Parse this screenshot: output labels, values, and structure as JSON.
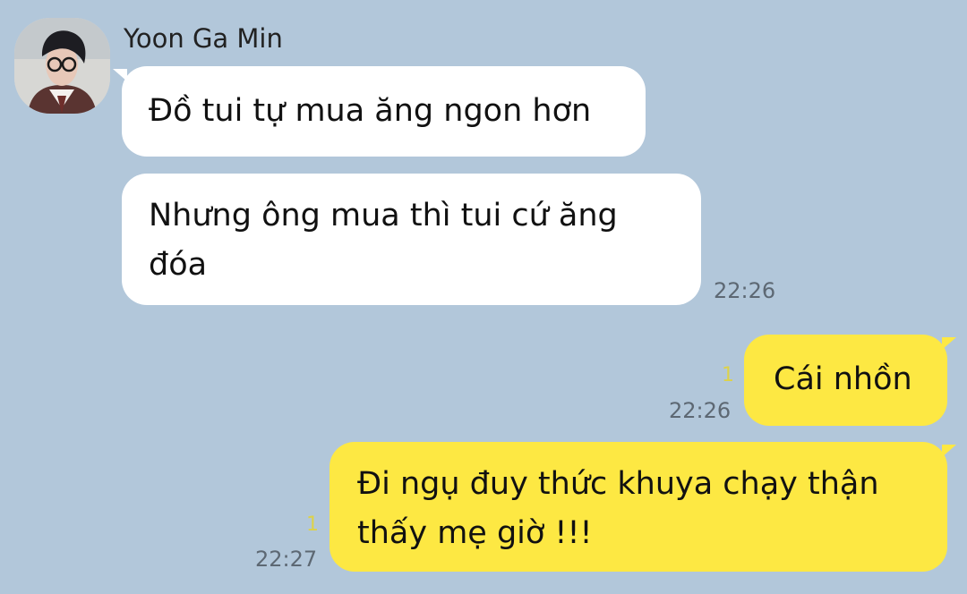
{
  "contact": {
    "name": "Yoon Ga Min",
    "avatar_icon": "profile-photo-avatar"
  },
  "messages": [
    {
      "direction": "incoming",
      "text": "Đồ tui tự mua ăng ngon hơn"
    },
    {
      "direction": "incoming",
      "text": "Nhưng ông mua thì tui cứ ăng đóa",
      "time": "22:26"
    },
    {
      "direction": "outgoing",
      "text": "Cái nhồn",
      "time": "22:26",
      "unread_count": "1"
    },
    {
      "direction": "outgoing",
      "text": "Đi ngụ đuy thức khuya chạy thận thấy mẹ giờ !!!",
      "time": "22:27",
      "unread_count": "1"
    }
  ],
  "theme": {
    "background": "#b2c7da",
    "incoming_bubble": "#ffffff",
    "outgoing_bubble": "#fde843",
    "unread_count_color": "#ddd24a"
  }
}
